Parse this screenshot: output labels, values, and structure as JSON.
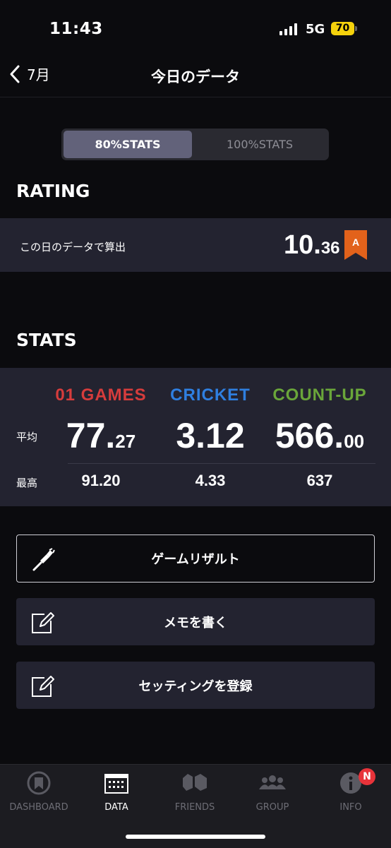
{
  "status": {
    "time": "11:43",
    "network": "5G",
    "battery": "70"
  },
  "nav": {
    "back_label": "7月",
    "title": "今日のデータ"
  },
  "segment": {
    "active": "80%STATS",
    "inactive": "100%STATS"
  },
  "rating": {
    "heading": "RATING",
    "row_label": "この日のデータで算出",
    "value_int": "10.",
    "value_dec": "36",
    "badge": "A",
    "badge_color": "#e2621b"
  },
  "stats": {
    "heading": "STATS",
    "avg_label": "平均",
    "best_label": "最高",
    "columns": [
      {
        "title": "01 GAMES",
        "color": "#d63c3c",
        "avg_int": "77.",
        "avg_dec": "27",
        "best": "91.20"
      },
      {
        "title": "CRICKET",
        "color": "#2f7fe0",
        "avg_int": "3.12",
        "avg_dec": "",
        "best": "4.33"
      },
      {
        "title": "COUNT-UP",
        "color": "#6aa63a",
        "avg_int": "566.",
        "avg_dec": "00",
        "best": "637"
      }
    ]
  },
  "buttons": {
    "game_result": "ゲームリザルト",
    "memo": "メモを書く",
    "setting": "セッティングを登録"
  },
  "tabs": [
    {
      "label": "DASHBOARD",
      "icon": "dashboard-icon"
    },
    {
      "label": "DATA",
      "icon": "calendar-icon"
    },
    {
      "label": "FRIENDS",
      "icon": "friends-icon"
    },
    {
      "label": "GROUP",
      "icon": "group-icon"
    },
    {
      "label": "INFO",
      "icon": "info-icon"
    }
  ],
  "info_badge": "N"
}
